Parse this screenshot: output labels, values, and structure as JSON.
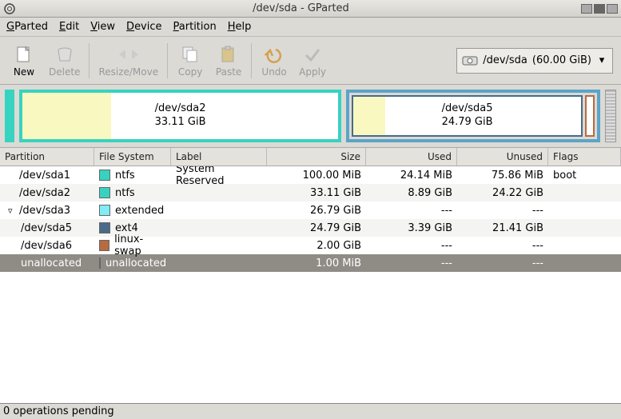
{
  "window": {
    "title": "/dev/sda - GParted"
  },
  "menu": {
    "gparted": "GParted",
    "edit": "Edit",
    "view": "View",
    "device": "Device",
    "partition": "Partition",
    "help": "Help"
  },
  "toolbar": {
    "new": "New",
    "delete": "Delete",
    "resize": "Resize/Move",
    "copy": "Copy",
    "paste": "Paste",
    "undo": "Undo",
    "apply": "Apply"
  },
  "device_selector": {
    "device": "/dev/sda",
    "size": "(60.00 GiB)"
  },
  "visual": {
    "p1": {
      "name": "/dev/sda2",
      "size": "33.11 GiB"
    },
    "p2": {
      "name": "/dev/sda5",
      "size": "24.79 GiB"
    }
  },
  "columns": {
    "partition": "Partition",
    "fs": "File System",
    "label": "Label",
    "size": "Size",
    "used": "Used",
    "unused": "Unused",
    "flags": "Flags"
  },
  "rows": [
    {
      "part": "/dev/sda1",
      "fs": "ntfs",
      "swatch": "#36d3c0",
      "label": "System Reserved",
      "size": "100.00 MiB",
      "used": "24.14 MiB",
      "unused": "75.86 MiB",
      "flags": "boot",
      "indent": 0
    },
    {
      "part": "/dev/sda2",
      "fs": "ntfs",
      "swatch": "#36d3c0",
      "label": "",
      "size": "33.11 GiB",
      "used": "8.89 GiB",
      "unused": "24.22 GiB",
      "flags": "",
      "indent": 0
    },
    {
      "part": "/dev/sda3",
      "fs": "extended",
      "swatch": "#7fecf6",
      "label": "",
      "size": "26.79 GiB",
      "used": "---",
      "unused": "---",
      "flags": "",
      "indent": 0,
      "expander": true
    },
    {
      "part": "/dev/sda5",
      "fs": "ext4",
      "swatch": "#4a6a8a",
      "label": "",
      "size": "24.79 GiB",
      "used": "3.39 GiB",
      "unused": "21.41 GiB",
      "flags": "",
      "indent": 1
    },
    {
      "part": "/dev/sda6",
      "fs": "linux-swap",
      "swatch": "#b86b3e",
      "label": "",
      "size": "2.00 GiB",
      "used": "---",
      "unused": "---",
      "flags": "",
      "indent": 1
    },
    {
      "part": "unallocated",
      "fs": "unallocated",
      "swatch": "#bdbdbd",
      "label": "",
      "size": "1.00 MiB",
      "used": "---",
      "unused": "---",
      "flags": "",
      "indent": 1,
      "selected": true
    }
  ],
  "status": "0 operations pending"
}
